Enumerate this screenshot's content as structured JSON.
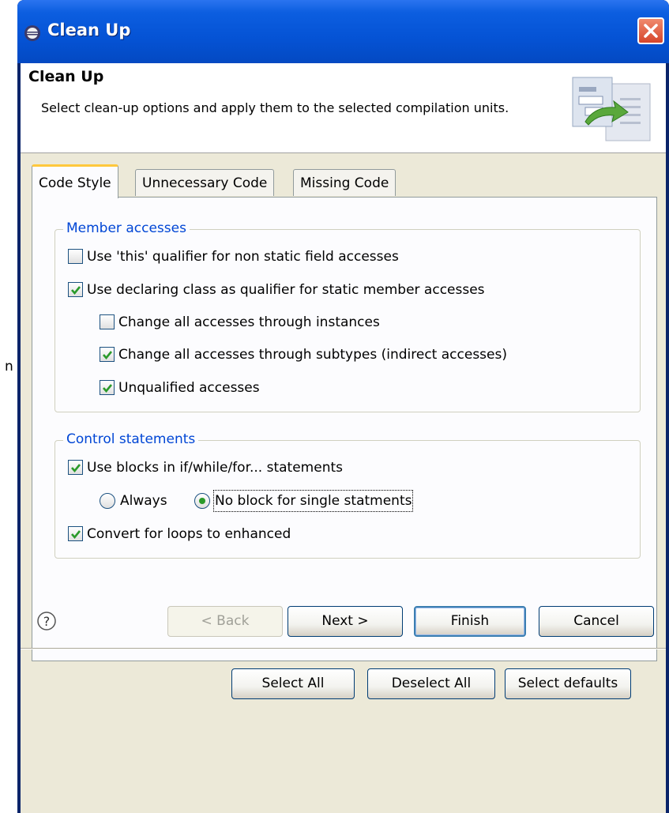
{
  "window": {
    "title": "Clean Up",
    "close_icon": "close-icon"
  },
  "background_edge_text": "n",
  "header": {
    "title": "Clean Up",
    "description": "Select clean-up options and apply them to the selected compilation units."
  },
  "tabs": [
    {
      "label": "Code Style",
      "active": true
    },
    {
      "label": "Unnecessary Code",
      "active": false
    },
    {
      "label": "Missing Code",
      "active": false
    }
  ],
  "member_accesses": {
    "legend": "Member accesses",
    "options": [
      {
        "label": "Use 'this' qualifier for non static field accesses",
        "checked": false
      },
      {
        "label": "Use declaring class as qualifier for static member accesses",
        "checked": true
      },
      {
        "label": "Change all accesses through instances",
        "checked": false
      },
      {
        "label": "Change all accesses through subtypes (indirect accesses)",
        "checked": true
      },
      {
        "label": "Unqualified accesses",
        "checked": true
      }
    ]
  },
  "control_statements": {
    "legend": "Control statements",
    "use_blocks": {
      "label": "Use blocks in if/while/for... statements",
      "checked": true
    },
    "radio_always": {
      "label": "Always",
      "selected": false
    },
    "radio_no_block": {
      "label": "No block for single statments",
      "selected": true
    },
    "convert_loops": {
      "label": "Convert for loops to enhanced",
      "checked": true
    }
  },
  "panel_buttons": {
    "select_all": "Select All",
    "deselect_all": "Deselect All",
    "select_defaults": "Select defaults"
  },
  "footer": {
    "help_icon": "help-icon",
    "back": "< Back",
    "next": "Next >",
    "finish": "Finish",
    "cancel": "Cancel"
  },
  "colors": {
    "titlebar": "#0553d5",
    "legend_text": "#0046d5",
    "check_green": "#2a9a2a"
  }
}
